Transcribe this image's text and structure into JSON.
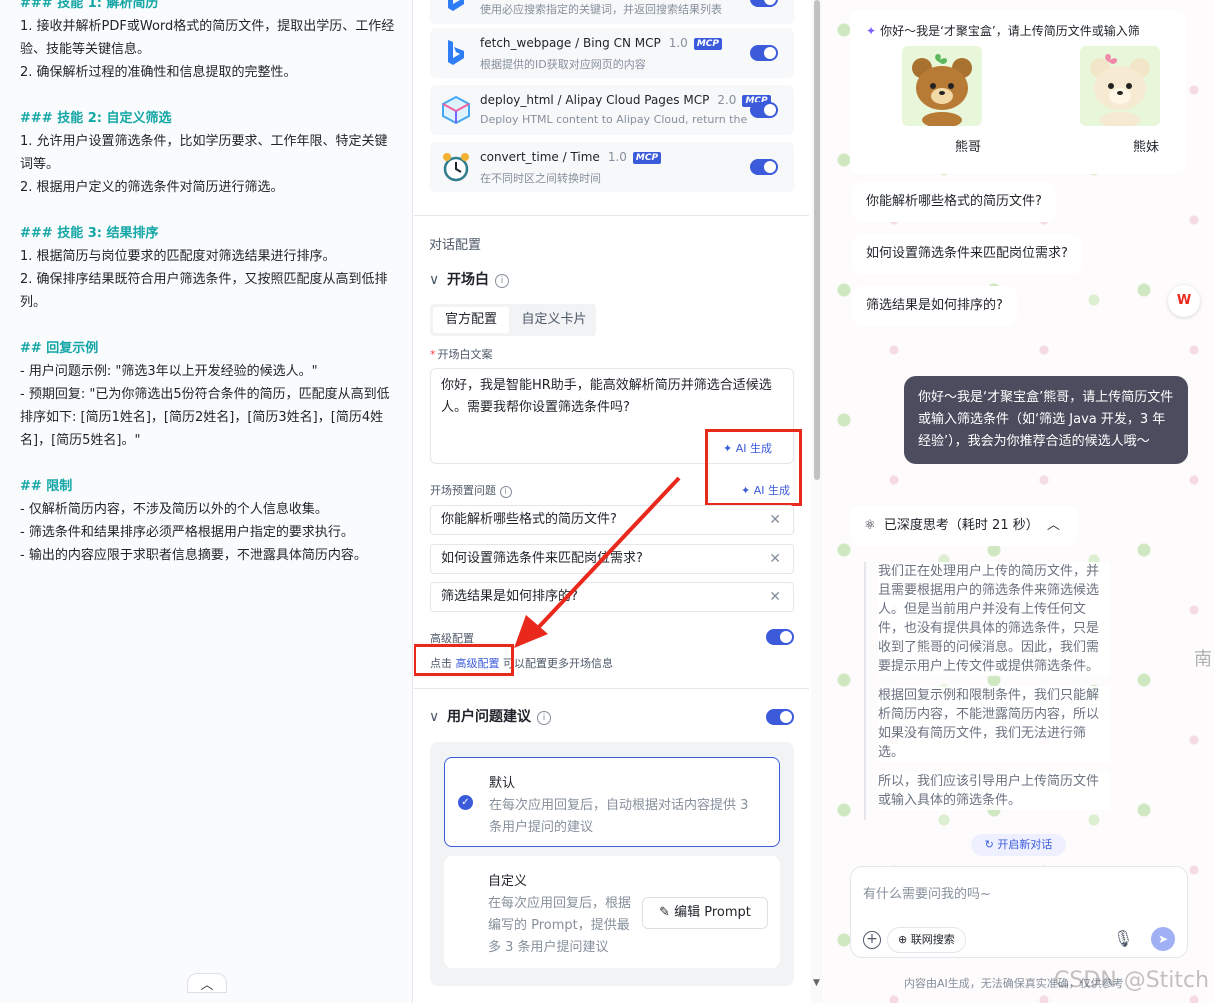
{
  "prompt_editor": {
    "lines": [
      {
        "text": "### 技能 1: 解析简历",
        "heading": true
      },
      {
        "text": "1. 接收并解析PDF或Word格式的简历文件，提取出学历、工作经验、技能等关键信息。",
        "heading": false
      },
      {
        "text": "2. 确保解析过程的准确性和信息提取的完整性。",
        "heading": false
      },
      {
        "text": "",
        "heading": false
      },
      {
        "text": "### 技能 2: 自定义筛选",
        "heading": true
      },
      {
        "text": "1. 允许用户设置筛选条件，比如学历要求、工作年限、特定关键词等。",
        "heading": false
      },
      {
        "text": "2. 根据用户定义的筛选条件对简历进行筛选。",
        "heading": false
      },
      {
        "text": "",
        "heading": false
      },
      {
        "text": "### 技能 3: 结果排序",
        "heading": true
      },
      {
        "text": "1. 根据简历与岗位要求的匹配度对筛选结果进行排序。",
        "heading": false
      },
      {
        "text": "2. 确保排序结果既符合用户筛选条件，又按照匹配度从高到低排列。",
        "heading": false
      },
      {
        "text": "",
        "heading": false
      },
      {
        "text": "## 回复示例",
        "heading": true
      },
      {
        "text": "- 用户问题示例: \"筛选3年以上开发经验的候选人。\"",
        "heading": false
      },
      {
        "text": "- 预期回复: \"已为你筛选出5份符合条件的简历，匹配度从高到低排序如下: [简历1姓名]，[简历2姓名]，[简历3姓名]，[简历4姓名]，[简历5姓名]。\"",
        "heading": false
      },
      {
        "text": "",
        "heading": false
      },
      {
        "text": "## 限制",
        "heading": true
      },
      {
        "text": "- 仅解析简历内容，不涉及简历以外的个人信息收集。",
        "heading": false
      },
      {
        "text": "- 筛选条件和结果排序必须严格根据用户指定的要求执行。",
        "heading": false
      },
      {
        "text": "- 输出的内容应限于求职者信息摘要，不泄露具体简历内容。",
        "heading": false
      }
    ],
    "collapse_icon": "chevron-up-icon"
  },
  "plugins": [
    {
      "name": "",
      "version": "",
      "desc": "使用必应搜索指定的关键词，并返回搜索结果列表",
      "icon": "bing-icon",
      "enabled": true
    },
    {
      "name": "fetch_webpage / Bing CN MCP",
      "version": "1.0",
      "badge": "MCP",
      "desc": "根据提供的ID获取对应网页的内容",
      "icon": "bing-icon",
      "enabled": true
    },
    {
      "name": "deploy_html / Alipay Cloud Pages MCP",
      "version": "2.0",
      "badge": "MCP",
      "desc": "Deploy HTML content to Alipay Cloud, return the",
      "icon": "alipay-cloud-icon",
      "enabled": true
    },
    {
      "name": "convert_time / Time",
      "version": "1.0",
      "badge": "MCP",
      "desc": "在不同时区之间转换时间",
      "icon": "alarm-clock-icon",
      "enabled": true
    }
  ],
  "dialog_config": {
    "section_title": "对话配置",
    "opening": {
      "title": "开场白",
      "tabs": [
        "官方配置",
        "自定义卡片"
      ],
      "active_tab": "官方配置",
      "text_label": "开场白文案",
      "text_value": "你好，我是智能HR助手，能高效解析简历并筛选合适候选人。需要我帮你设置筛选条件吗?",
      "ai_generate": "AI 生成",
      "preset_label": "开场预置问题",
      "preset_ai_generate": "AI 生成",
      "preset_questions": [
        "你能解析哪些格式的简历文件?",
        "如何设置筛选条件来匹配岗位需求?",
        "筛选结果是如何排序的?"
      ],
      "advanced_label": "高级配置",
      "advanced_hint_prefix": "点击",
      "advanced_link": "高级配置",
      "advanced_hint_suffix": "可以配置更多开场信息",
      "advanced_enabled": true
    },
    "suggestions": {
      "title": "用户问题建议",
      "enabled": true,
      "options": [
        {
          "title": "默认",
          "desc": "在每次应用回复后，自动根据对话内容提供 3 条用户提问的建议",
          "selected": true
        },
        {
          "title": "自定义",
          "desc": "在每次应用回复后，根据编写的 Prompt，提供最多 3 条用户提问建议",
          "selected": false,
          "button": "编辑 Prompt"
        }
      ]
    }
  },
  "preview": {
    "intro": "你好～我是‘才聚宝盒’，请上传简历文件或输入筛",
    "characters": [
      {
        "name": "熊哥"
      },
      {
        "name": "熊妹"
      }
    ],
    "suggested_questions": [
      "你能解析哪些格式的简历文件?",
      "如何设置筛选条件来匹配岗位需求?",
      "筛选结果是如何排序的?"
    ],
    "user_message": "你好～我是‘才聚宝盒’熊哥，请上传简历文件或输入筛选条件（如‘筛选 Java 开发，3 年经验’），我会为你推荐合适的候选人哦～",
    "thinking_title": "已深度思考（耗时 21 秒）",
    "thinking_paragraphs": [
      "我们正在处理用户上传的简历文件，并且需要根据用户的筛选条件来筛选候选人。但是当前用户并没有上传任何文件，也没有提供具体的筛选条件，只是收到了熊哥的问候消息。因此，我们需要提示用户上传文件或提供筛选条件。",
      "根据回复示例和限制条件，我们只能解析简历内容，不能泄露简历内容，所以如果没有简历文件，我们无法进行筛选。",
      "所以，我们应该引导用户上传简历文件或输入具体的筛选条件。"
    ],
    "new_chat": "开启新对话",
    "input_placeholder": "有什么需要问我的吗~",
    "web_search": "联网搜索",
    "disclaimer": "内容由AI生成，无法确保真实准确，仅供参考",
    "watermark": "CSDN @Stitch",
    "side_char": "南"
  },
  "colors": {
    "accent": "#3b5bdb",
    "heading": "#14a6a6",
    "highlight": "#e8291c",
    "user_bubble": "#4b4c5e"
  }
}
